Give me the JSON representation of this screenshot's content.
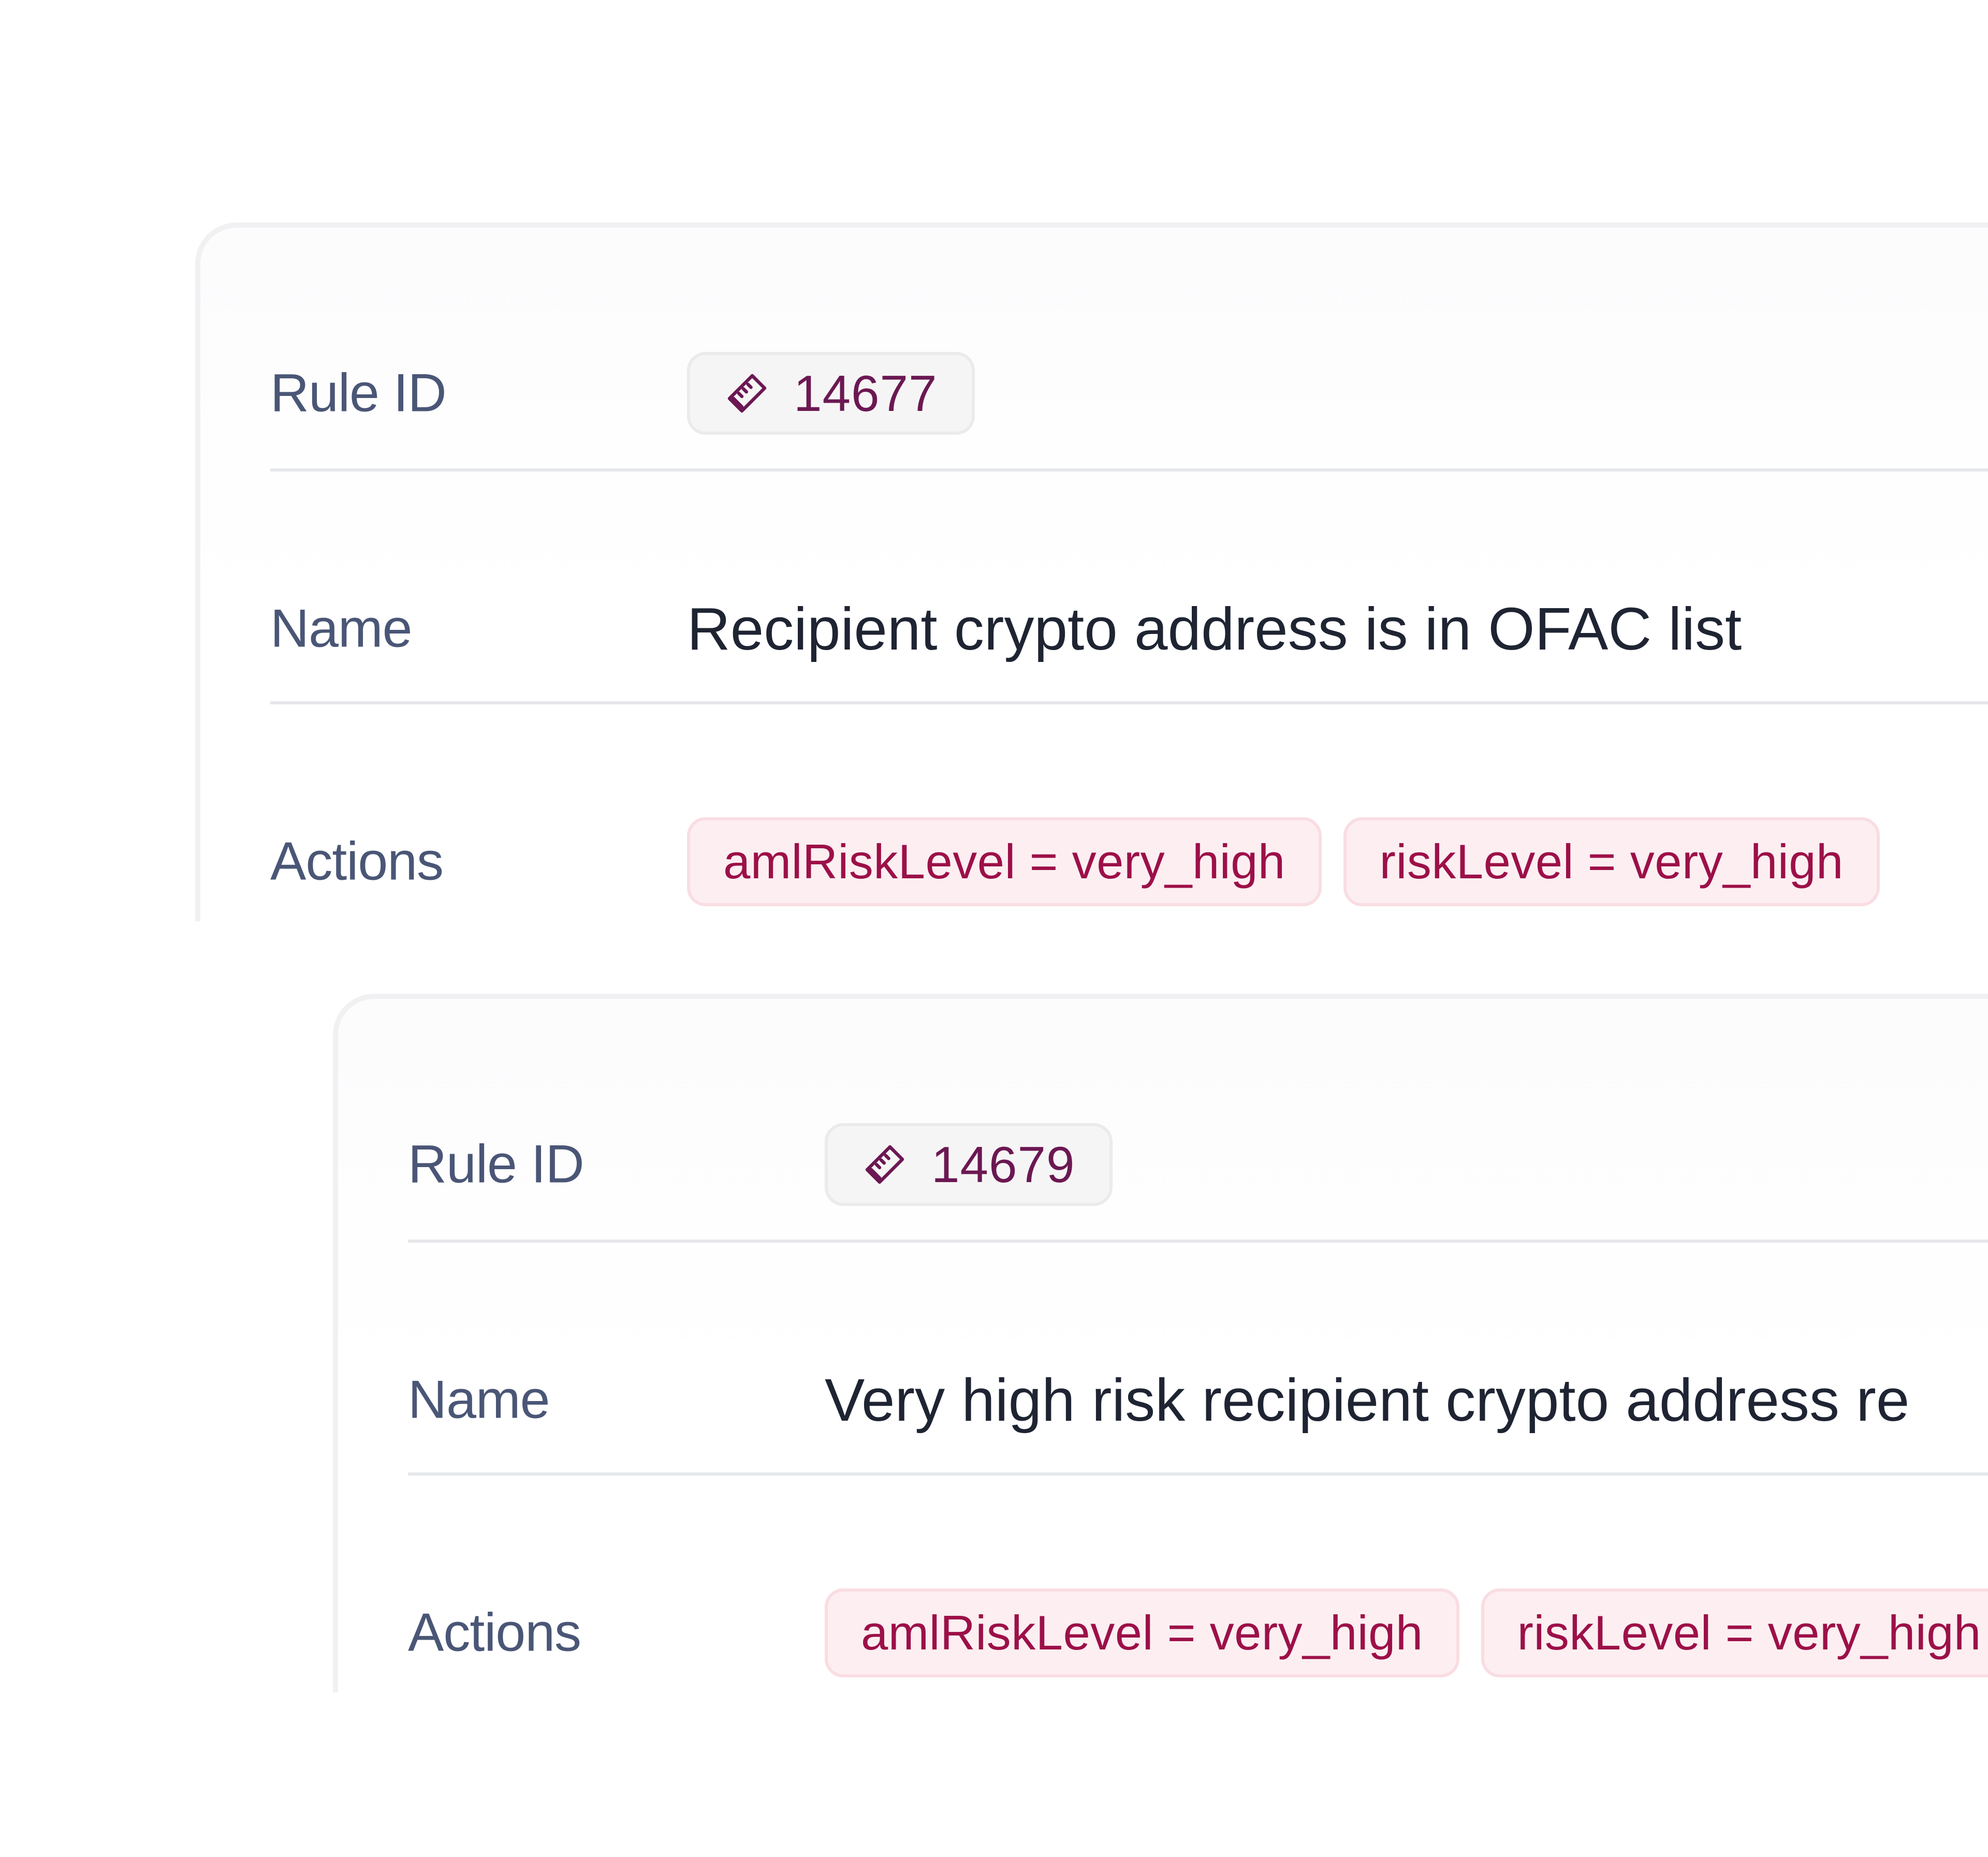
{
  "cards": [
    {
      "rule_id_label": "Rule ID",
      "rule_id": "14677",
      "rule_icon": "ticket-icon",
      "name_label": "Name",
      "name": "Recipient crypto address is in OFAC list",
      "actions_label": "Actions",
      "actions": [
        "amlRiskLevel = very_high",
        "riskLevel = very_high"
      ]
    },
    {
      "rule_id_label": "Rule ID",
      "rule_id": "14679",
      "rule_icon": "ticket-icon",
      "name_label": "Name",
      "name": "Very high risk recipient crypto address re",
      "actions_label": "Actions",
      "actions": [
        "amlRiskLevel = very_high",
        "riskLevel = very_high"
      ]
    }
  ],
  "colors": {
    "label": "#4a5676",
    "id_text": "#6b1853",
    "action_text": "#9c1048",
    "action_bg": "#fdeef1"
  }
}
